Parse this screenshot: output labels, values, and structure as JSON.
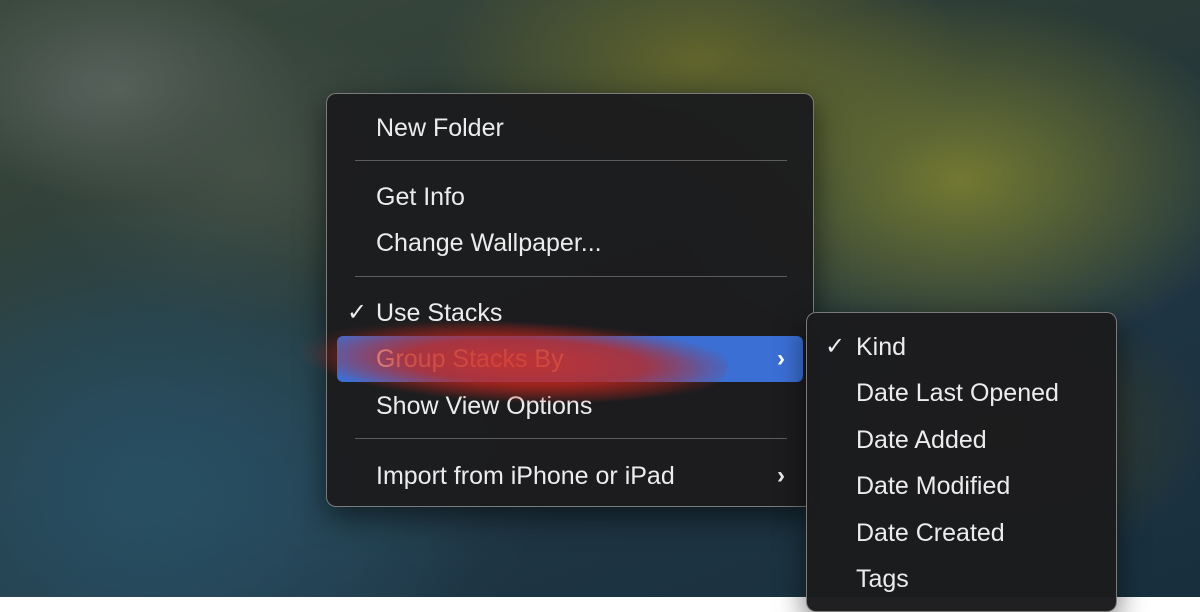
{
  "context_menu": {
    "items": [
      {
        "label": "New Folder"
      },
      {
        "label": "Get Info"
      },
      {
        "label": "Change Wallpaper..."
      },
      {
        "label": "Use Stacks",
        "checked": true,
        "check_glyph": "✓"
      },
      {
        "label": "Group Stacks By",
        "highlighted": true,
        "submenu": true,
        "chevron_glyph": "›"
      },
      {
        "label": "Show View Options"
      },
      {
        "label": "Import from iPhone or iPad",
        "submenu": true,
        "chevron_glyph": "›"
      }
    ]
  },
  "submenu": {
    "items": [
      {
        "label": "Kind",
        "checked": true,
        "check_glyph": "✓"
      },
      {
        "label": "Date Last Opened"
      },
      {
        "label": "Date Added"
      },
      {
        "label": "Date Modified"
      },
      {
        "label": "Date Created"
      },
      {
        "label": "Tags"
      }
    ]
  },
  "colors": {
    "highlight": "#3b6fd4",
    "menu_background": "#1c1c1e",
    "scribble": "#c82a20"
  }
}
